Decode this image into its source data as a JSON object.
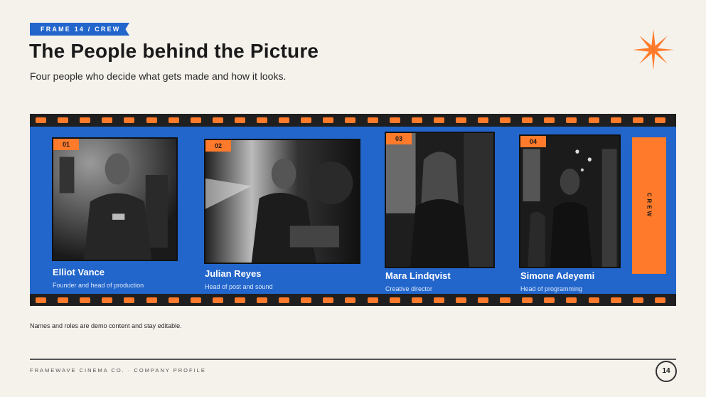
{
  "header": {
    "tag": "FRAME 14 / CREW",
    "title": "The People behind the Picture",
    "subtitle": "Four people who decide what gets made and how it looks."
  },
  "crew": [
    {
      "number": "01",
      "name": "Elliot Vance",
      "role": "Founder and head of production"
    },
    {
      "number": "02",
      "name": "Julian Reyes",
      "role": "Head of post and sound"
    },
    {
      "number": "03",
      "name": "Mara Lindqvist",
      "role": "Creative director"
    },
    {
      "number": "04",
      "name": "Simone Adeyemi",
      "role": "Head of programming"
    }
  ],
  "side_tab": "CREW",
  "note": "Names and roles are demo content and stay editable.",
  "footer": {
    "company": "FRAMEWAVE CINEMA CO. · COMPANY PROFILE",
    "page": "14"
  },
  "colors": {
    "accent": "#ff7a2a",
    "band": "#2266cc",
    "film": "#1f1f1f",
    "background": "#f5f2ec"
  },
  "icons": [
    "starburst-icon",
    "film-perforation",
    "page-number-badge"
  ]
}
